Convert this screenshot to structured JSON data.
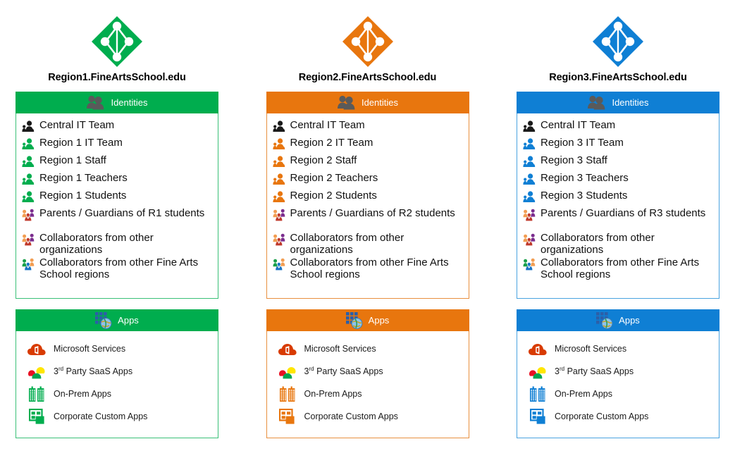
{
  "columns": [
    {
      "id": "region1",
      "theme": "#00AD4E",
      "border": "#3ac077",
      "tenant": "Region1.FineArtsSchool.edu",
      "logo_icon": "azure-ad-diamond-icon",
      "identities": {
        "header": "Identities",
        "header_icon": "people-group-icon",
        "items": [
          {
            "label": "Central IT Team",
            "icon": "people-icon",
            "style": "dark"
          },
          {
            "label": "Region 1 IT Team",
            "icon": "people-icon",
            "style": "theme"
          },
          {
            "label": "Region 1 Staff",
            "icon": "people-icon",
            "style": "theme"
          },
          {
            "label": "Region 1 Teachers",
            "icon": "people-icon",
            "style": "theme"
          },
          {
            "label": "Region 1 Students",
            "icon": "people-icon",
            "style": "theme"
          },
          {
            "label": "Parents / Guardians of R1 students",
            "icon": "external-people-icon",
            "style": "multi-warm"
          },
          {
            "label": "Collaborators from other organizations",
            "icon": "external-people-icon",
            "style": "multi-warm"
          },
          {
            "label": "Collaborators from other Fine Arts School regions",
            "icon": "external-people-icon",
            "style": "multi-cool"
          }
        ]
      },
      "apps": {
        "header": "Apps",
        "header_icon": "apps-globe-icon",
        "items": [
          {
            "label": "Microsoft Services",
            "label_sup": "",
            "icon": "office-cloud-icon"
          },
          {
            "label": "Party SaaS Apps",
            "label_pre": "3",
            "label_sup": "rd",
            "icon": "saas-clouds-icon"
          },
          {
            "label": "On-Prem Apps",
            "label_sup": "",
            "icon": "buildings-icon"
          },
          {
            "label": "Corporate Custom Apps",
            "label_sup": "",
            "icon": "window-tiles-icon"
          }
        ]
      }
    },
    {
      "id": "region2",
      "theme": "#E8760E",
      "border": "#e8903f",
      "tenant": "Region2.FineArtsSchool.edu",
      "logo_icon": "azure-ad-diamond-icon",
      "identities": {
        "header": "Identities",
        "header_icon": "people-group-icon",
        "items": [
          {
            "label": "Central IT Team",
            "icon": "people-icon",
            "style": "dark"
          },
          {
            "label": "Region 2 IT Team",
            "icon": "people-icon",
            "style": "theme"
          },
          {
            "label": "Region 2 Staff",
            "icon": "people-icon",
            "style": "theme"
          },
          {
            "label": "Region 2 Teachers",
            "icon": "people-icon",
            "style": "theme"
          },
          {
            "label": "Region 2 Students",
            "icon": "people-icon",
            "style": "theme"
          },
          {
            "label": "Parents / Guardians of R2 students",
            "icon": "external-people-icon",
            "style": "multi-warm"
          },
          {
            "label": "Collaborators from other organizations",
            "icon": "external-people-icon",
            "style": "multi-warm"
          },
          {
            "label": "Collaborators from other Fine Arts School regions",
            "icon": "external-people-icon",
            "style": "multi-cool"
          }
        ]
      },
      "apps": {
        "header": "Apps",
        "header_icon": "apps-globe-icon",
        "items": [
          {
            "label": "Microsoft Services",
            "label_sup": "",
            "icon": "office-cloud-icon"
          },
          {
            "label": "Party SaaS Apps",
            "label_pre": "3",
            "label_sup": "rd",
            "icon": "saas-clouds-icon"
          },
          {
            "label": "On-Prem Apps",
            "label_sup": "",
            "icon": "buildings-icon"
          },
          {
            "label": "Corporate Custom Apps",
            "label_sup": "",
            "icon": "window-tiles-icon"
          }
        ]
      }
    },
    {
      "id": "region3",
      "theme": "#0F7FD4",
      "border": "#4aa3e0",
      "tenant": "Region3.FineArtsSchool.edu",
      "logo_icon": "azure-ad-diamond-icon",
      "identities": {
        "header": "Identities",
        "header_icon": "people-group-icon",
        "items": [
          {
            "label": "Central IT Team",
            "icon": "people-icon",
            "style": "dark"
          },
          {
            "label": "Region 3 IT Team",
            "icon": "people-icon",
            "style": "theme"
          },
          {
            "label": "Region 3 Staff",
            "icon": "people-icon",
            "style": "theme"
          },
          {
            "label": "Region 3 Teachers",
            "icon": "people-icon",
            "style": "theme"
          },
          {
            "label": "Region 3 Students",
            "icon": "people-icon",
            "style": "theme"
          },
          {
            "label": "Parents / Guardians of R3 students",
            "icon": "external-people-icon",
            "style": "multi-warm"
          },
          {
            "label": "Collaborators from other organizations",
            "icon": "external-people-icon",
            "style": "multi-warm"
          },
          {
            "label": "Collaborators from other Fine Arts School regions",
            "icon": "external-people-icon",
            "style": "multi-cool"
          }
        ]
      },
      "apps": {
        "header": "Apps",
        "header_icon": "apps-globe-icon",
        "items": [
          {
            "label": "Microsoft Services",
            "label_sup": "",
            "icon": "office-cloud-icon"
          },
          {
            "label": "Party SaaS Apps",
            "label_pre": "3",
            "label_sup": "rd",
            "icon": "saas-clouds-icon"
          },
          {
            "label": "On-Prem Apps",
            "label_sup": "",
            "icon": "buildings-icon"
          },
          {
            "label": "Corporate Custom Apps",
            "label_sup": "",
            "icon": "window-tiles-icon"
          }
        ]
      }
    }
  ],
  "palette": {
    "green": "#00AD4E",
    "orange": "#E8760E",
    "blue": "#0F7FD4",
    "icon_dark": "#1a1a1a",
    "header_icon_gray": "#5a5a5a",
    "office_red": "#D83B01",
    "cloud_red": "#E81123",
    "cloud_yellow": "#FFE600",
    "cloud_green": "#00A651",
    "ext_orange": "#F29D52",
    "ext_purple": "#7B2D8E",
    "ext_red": "#C0392B",
    "ext_green": "#1AA04A",
    "ext_blue": "#1673C4"
  }
}
